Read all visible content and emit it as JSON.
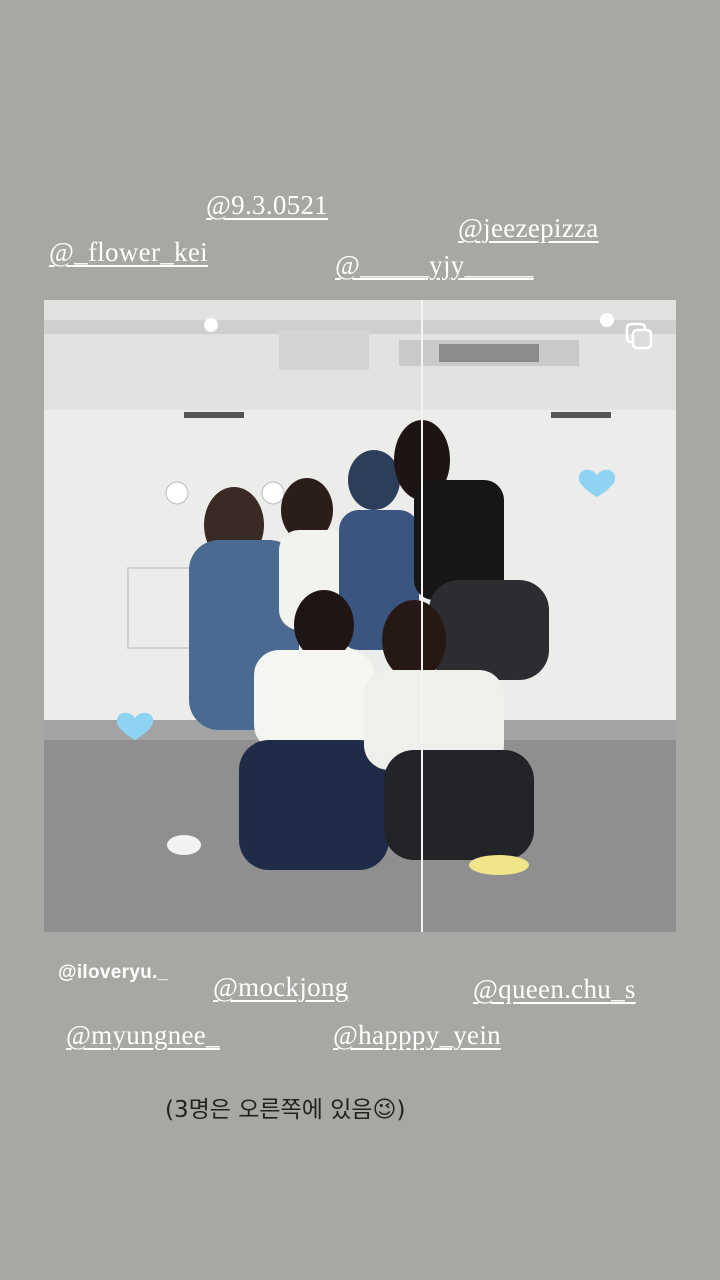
{
  "tags": {
    "t1": "@9.3.0521",
    "t2": "@_flower_kei",
    "t3": "@jeezepizza",
    "t4": "@_____yjy_____",
    "t5": "@iloveryu._",
    "t6": "@mockjong",
    "t7": "@queen.chu_s",
    "t8": "@myungnee_",
    "t9": "@happpy_yein"
  },
  "caption": "(3명은 오른쪽에 있음😉)",
  "icons": {
    "heart": "light-blue-heart",
    "multi": "multiple-images-icon"
  },
  "colors": {
    "background": "#a9a7a3",
    "heart": "#8fd3f2"
  }
}
